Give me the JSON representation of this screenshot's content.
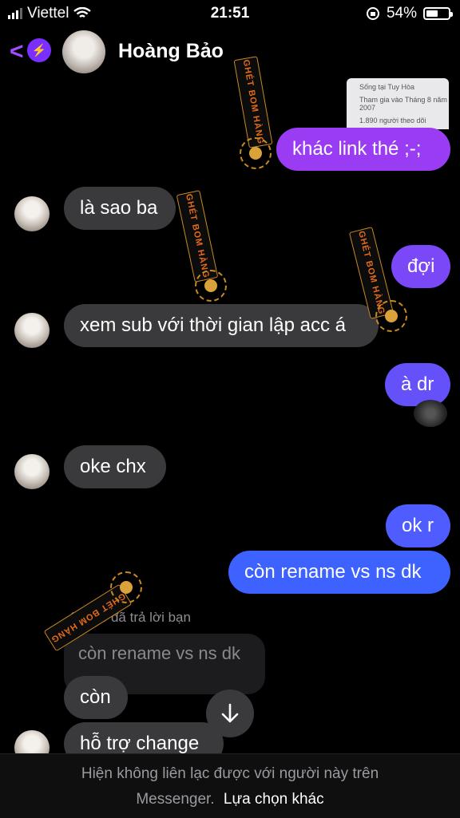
{
  "status_bar": {
    "carrier": "Viettel",
    "time": "21:51",
    "battery": "54%",
    "battery_level": 0.54
  },
  "header": {
    "contact_name": "Hoàng Bảo",
    "back_icon": "chevron-left-icon"
  },
  "messages": [
    {
      "dir": "out",
      "text": "khác link thé ;-;"
    },
    {
      "dir": "in",
      "text": "là sao ba"
    },
    {
      "dir": "out",
      "text": "đợi"
    },
    {
      "dir": "in",
      "text": "xem sub với thời gian lập acc á"
    },
    {
      "dir": "out",
      "text": "à dr"
    },
    {
      "dir": "in",
      "text": "oke chx"
    },
    {
      "dir": "out",
      "text": "ok r"
    },
    {
      "dir": "out",
      "text": "còn rename vs ns dk"
    },
    {
      "dir": "in",
      "text": "còn"
    },
    {
      "dir": "in",
      "text": "hỗ trợ change"
    }
  ],
  "reply": {
    "meta": "Bảo đã trả lời bạn",
    "quoted": "còn rename vs ns dk"
  },
  "thumbnail": {
    "lines": [
      "Sống tại Tuy Hòa",
      "Tham gia vào Tháng 8 năm 2007",
      "1.890 người theo dõi"
    ]
  },
  "watermark": {
    "text": "GHÉT BOM HÀNG"
  },
  "footer": {
    "notice": "Hiện không liên lạc được với người này trên",
    "notice_2": "Messenger.",
    "action": "Lựa chọn khác"
  },
  "colors": {
    "accent": "#8b3dff",
    "out_top": "#9b3cf2",
    "out_bottom": "#3b63ff",
    "incoming": "#3a3a3c"
  }
}
